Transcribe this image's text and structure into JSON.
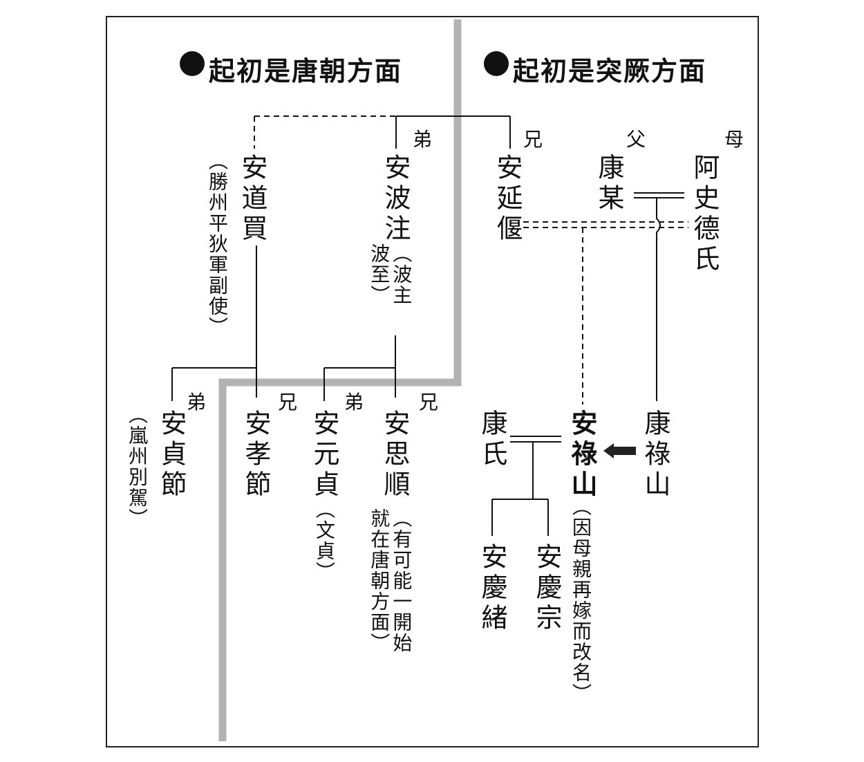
{
  "titles": {
    "tang_side": "起初是唐朝方面",
    "turk_side": "起初是突厥方面"
  },
  "people": {
    "an_daomai": "安道買",
    "an_daomai_note": "（勝州平狄軍副使）",
    "an_bozhu": "安波注",
    "an_bozhu_note": "（波主\n波至）",
    "an_yanyan": "安延偃",
    "kang_mou": "康某",
    "ashide_shi": "阿史德氏",
    "an_zhenjie": "安貞節",
    "an_zhenjie_note": "（嵐州別駕）",
    "an_xiaojie": "安孝節",
    "an_yuanzhen": "安元貞",
    "an_yuanzhen_note": "（文貞）",
    "an_sishun": "安思順",
    "an_sishun_note": "（有可能一開始\n就在唐朝方面）",
    "kang_shi": "康氏",
    "an_lushan": "安祿山",
    "an_lushan_note": "（因母親再嫁而改名）",
    "kang_lushan": "康祿山",
    "an_qingxu": "安慶緒",
    "an_qingzong": "安慶宗"
  },
  "relations": {
    "younger_brother": "弟",
    "elder_brother": "兄",
    "father": "父",
    "mother": "母"
  },
  "colors": {
    "divider": "#b3b3b3",
    "line": "#111111",
    "arrow": "#222222"
  }
}
